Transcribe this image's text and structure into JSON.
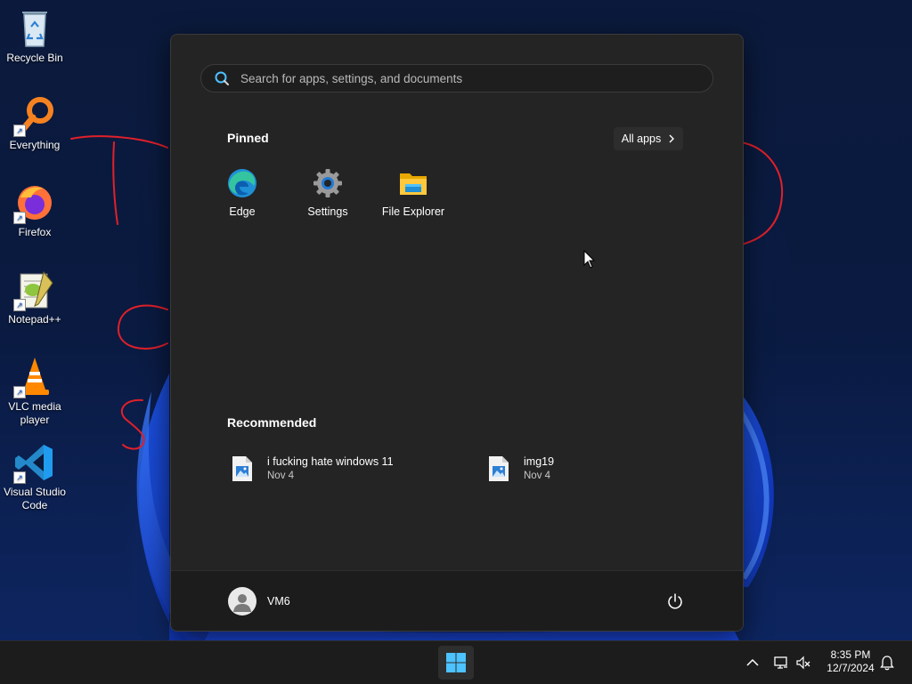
{
  "desktop": {
    "icons": [
      {
        "label": "Recycle Bin",
        "icon": "recycle-bin-icon"
      },
      {
        "label": "Everything",
        "icon": "everything-search-icon"
      },
      {
        "label": "Firefox",
        "icon": "firefox-icon"
      },
      {
        "label": "Notepad++",
        "icon": "notepad-plus-plus-icon"
      },
      {
        "label": "VLC media player",
        "icon": "vlc-icon"
      },
      {
        "label": "Visual Studio Code",
        "icon": "vscode-icon"
      }
    ],
    "annotation_color": "#e0202a"
  },
  "start_menu": {
    "search": {
      "placeholder": "Search for apps, settings, and documents",
      "value": ""
    },
    "pinned_title": "Pinned",
    "all_apps_label": "All apps",
    "pinned": [
      {
        "label": "Edge",
        "icon": "edge-icon"
      },
      {
        "label": "Settings",
        "icon": "settings-gear-icon"
      },
      {
        "label": "File Explorer",
        "icon": "folder-icon"
      }
    ],
    "recommended_title": "Recommended",
    "recommended": [
      {
        "name": "i fucking hate windows 11",
        "date": "Nov 4",
        "icon": "image-file-icon"
      },
      {
        "name": "img19",
        "date": "Nov 4",
        "icon": "image-file-icon"
      }
    ],
    "user": {
      "name": "VM6"
    },
    "power_icon": "power-icon"
  },
  "taskbar": {
    "time": "8:35 PM",
    "date": "12/7/2024",
    "accent": "#4cc2ff"
  }
}
